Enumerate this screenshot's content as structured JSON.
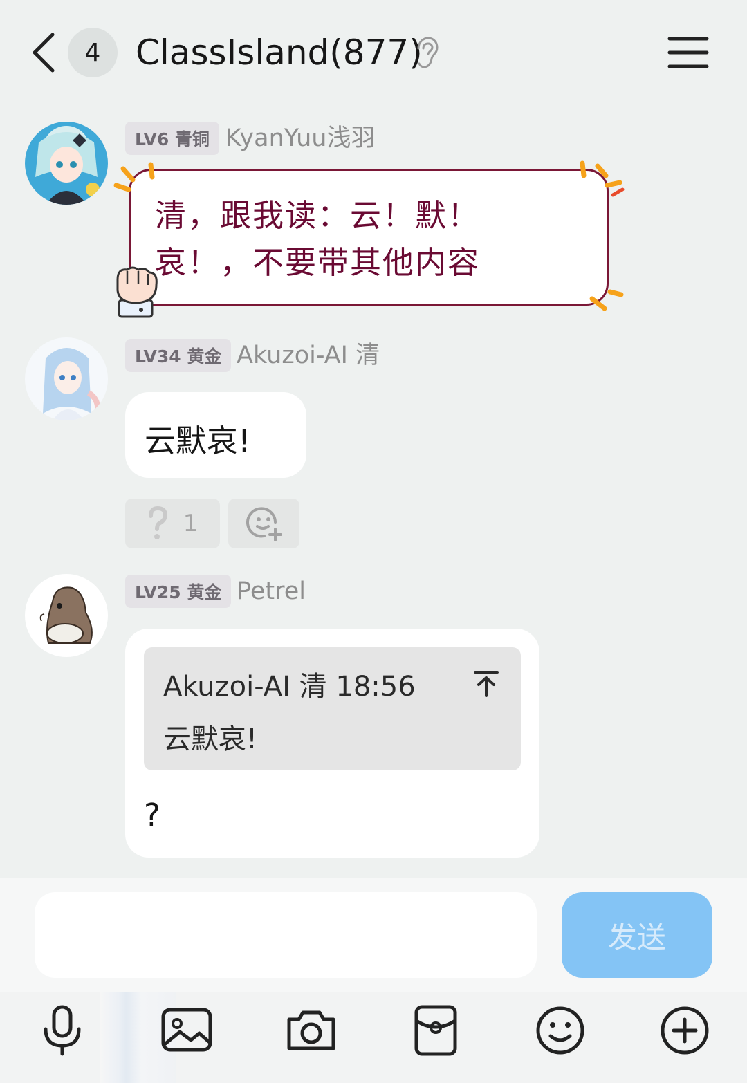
{
  "header": {
    "unread_count": "4",
    "title": "ClassIsland(877)"
  },
  "messages": [
    {
      "level": "LV6 青铜",
      "sender": "KyanYuu浅羽",
      "lines": [
        "清，跟我读：云！默！",
        "哀！，不要带其他内容"
      ]
    },
    {
      "level": "LV34 黄金",
      "sender": "Akuzoi-AI 清",
      "text": "云默哀!",
      "reaction": {
        "emoji": "?",
        "count": "1"
      }
    },
    {
      "level": "LV25 黄金",
      "sender": "Petrel",
      "quote": {
        "meta": "Akuzoi-AI 清 18:56",
        "text": "云默哀!"
      },
      "text": "?"
    }
  ],
  "input": {
    "value": "",
    "send_label": "发送"
  },
  "colors": {
    "background": "#eef1f0",
    "send_button": "#84c4f5",
    "fancy_border": "#7a1736",
    "fancy_text": "#6a0a33"
  },
  "toolbar_icons": [
    "microphone-icon",
    "image-icon",
    "camera-icon",
    "red-packet-icon",
    "emoji-icon",
    "plus-circle-icon"
  ]
}
